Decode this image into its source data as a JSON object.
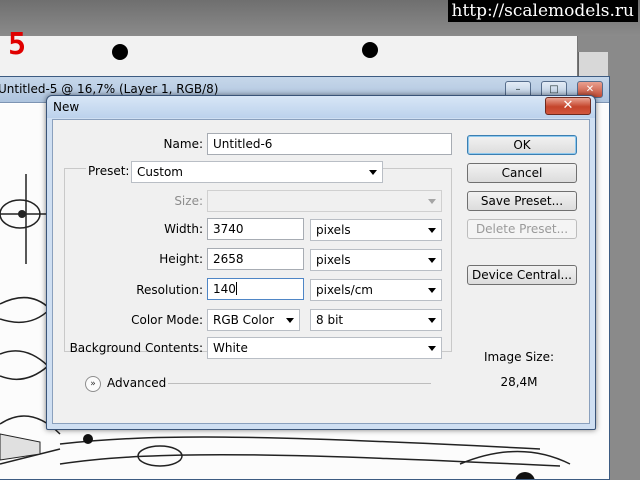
{
  "watermark": "http://scalemodels.ru",
  "page_number": "5",
  "doc_window": {
    "title": "Untitled-5 @ 16,7% (Layer 1, RGB/8)",
    "minimize_glyph": "–",
    "maximize_glyph": "□",
    "close_glyph": "✕"
  },
  "dialog": {
    "title": "New",
    "close_glyph": "✕",
    "name_label": "Name:",
    "name_value": "Untitled-6",
    "preset_label": "Preset:",
    "preset_value": "Custom",
    "size_label": "Size:",
    "size_value": "",
    "width_label": "Width:",
    "width_value": "3740",
    "width_unit": "pixels",
    "height_label": "Height:",
    "height_value": "2658",
    "height_unit": "pixels",
    "resolution_label": "Resolution:",
    "resolution_value": "140",
    "resolution_unit": "pixels/cm",
    "color_mode_label": "Color Mode:",
    "color_mode_value": "RGB Color",
    "bit_depth_value": "8 bit",
    "background_label": "Background Contents:",
    "background_value": "White",
    "advanced_label": "Advanced",
    "advanced_glyph": "»",
    "buttons": {
      "ok": "OK",
      "cancel": "Cancel",
      "save_preset": "Save Preset...",
      "delete_preset": "Delete Preset...",
      "device_central": "Device Central..."
    },
    "image_size_label": "Image Size:",
    "image_size_value": "28,4M"
  },
  "colors": {
    "accent_blue": "#3c7fb1",
    "close_red": "#c5442b",
    "page_number_red": "#e00000"
  }
}
